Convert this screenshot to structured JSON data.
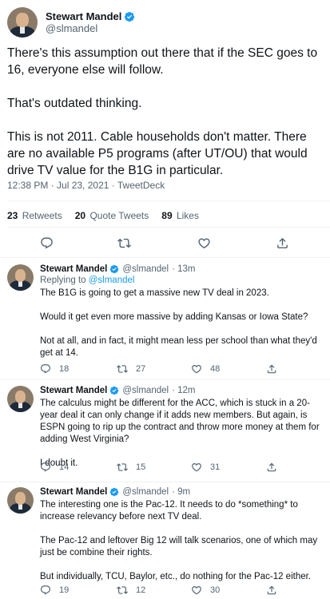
{
  "main_tweet": {
    "author_name": "Stewart Mandel",
    "handle": "@slmandel",
    "paragraphs": [
      "There's this assumption out there that if the SEC goes to 16, everyone else will follow.",
      "That's outdated thinking.",
      "This is not 2011. Cable households don't matter. There are no available P5 programs (after UT/OU) that would drive TV value for the B1G in particular."
    ],
    "timestamp": "12:38 PM · Jul 23, 2021 · TweetDeck",
    "stats": {
      "retweets_count": "23",
      "retweets_label": "Retweets",
      "quotes_count": "20",
      "quotes_label": "Quote Tweets",
      "likes_count": "89",
      "likes_label": "Likes"
    }
  },
  "replies": [
    {
      "author_name": "Stewart Mandel",
      "handle": "@slmandel",
      "age": "· 13m",
      "replying_prefix": "Replying to",
      "replying_to": "@slmandel",
      "paragraphs": [
        "The B1G is going to get a massive new TV deal in 2023.",
        "Would it get even more massive by adding Kansas or Iowa State?",
        "Not at all, and in fact, it might mean less per school than what they'd get at 14."
      ],
      "reply_count": "18",
      "retweet_count": "27",
      "like_count": "48"
    },
    {
      "author_name": "Stewart Mandel",
      "handle": "@slmandel",
      "age": "· 12m",
      "paragraphs": [
        "The calculus might be different for the ACC, which is stuck in a 20-year deal it can only change if it adds new members. But again, is ESPN going to rip up the contract and throw more money at them for adding West Virginia?",
        "I doubt it."
      ],
      "reply_count": "14",
      "retweet_count": "15",
      "like_count": "31"
    },
    {
      "author_name": "Stewart Mandel",
      "handle": "@slmandel",
      "age": "· 9m",
      "paragraphs": [
        "The interesting one is the Pac-12. It needs to do *something* to increase relevancy before next TV deal.",
        "The Pac-12 and leftover Big 12 will talk scenarios, one of which may just be combine their rights.",
        "But individually, TCU, Baylor, etc., do nothing for the Pac-12 either."
      ],
      "reply_count": "19",
      "retweet_count": "12",
      "like_count": "30"
    }
  ],
  "icons": [
    "reply-icon",
    "retweet-icon",
    "like-icon",
    "share-icon",
    "verified-badge-icon"
  ],
  "colors": {
    "text": "#0f1419",
    "secondary": "#536471",
    "accent": "#1d9bf0",
    "divider": "#eff3f4"
  }
}
